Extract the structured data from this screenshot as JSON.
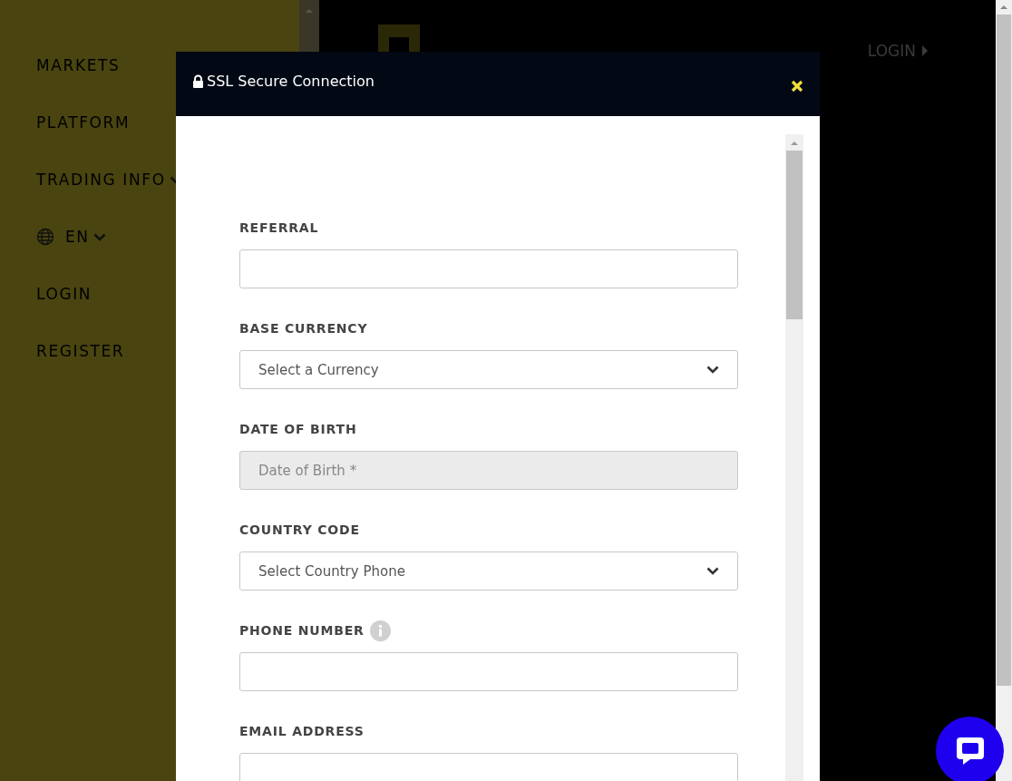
{
  "sidebar": {
    "items": [
      {
        "label": "MARKETS",
        "kind": "link"
      },
      {
        "label": "PLATFORM",
        "kind": "link"
      },
      {
        "label": "TRADING INFO",
        "kind": "dropdown"
      },
      {
        "label": "EN",
        "kind": "language"
      },
      {
        "label": "LOGIN",
        "kind": "link"
      },
      {
        "label": "REGISTER",
        "kind": "link"
      }
    ]
  },
  "header": {
    "login": "LOGIN"
  },
  "modal": {
    "title": "SSL Secure Connection",
    "fields": [
      {
        "label": "REFERRAL",
        "kind": "text",
        "disabled": false,
        "info": false
      },
      {
        "label": "BASE CURRENCY",
        "kind": "select",
        "value": "Select a Currency",
        "disabled": false,
        "info": false
      },
      {
        "label": "DATE OF BIRTH",
        "kind": "text",
        "placeholder": "Date of Birth *",
        "disabled": true,
        "info": false
      },
      {
        "label": "COUNTRY CODE",
        "kind": "select",
        "value": "Select Country Phone",
        "disabled": false,
        "info": false
      },
      {
        "label": "PHONE NUMBER",
        "kind": "text",
        "disabled": false,
        "info": true
      },
      {
        "label": "EMAIL ADDRESS",
        "kind": "text",
        "disabled": false,
        "info": false
      }
    ]
  }
}
